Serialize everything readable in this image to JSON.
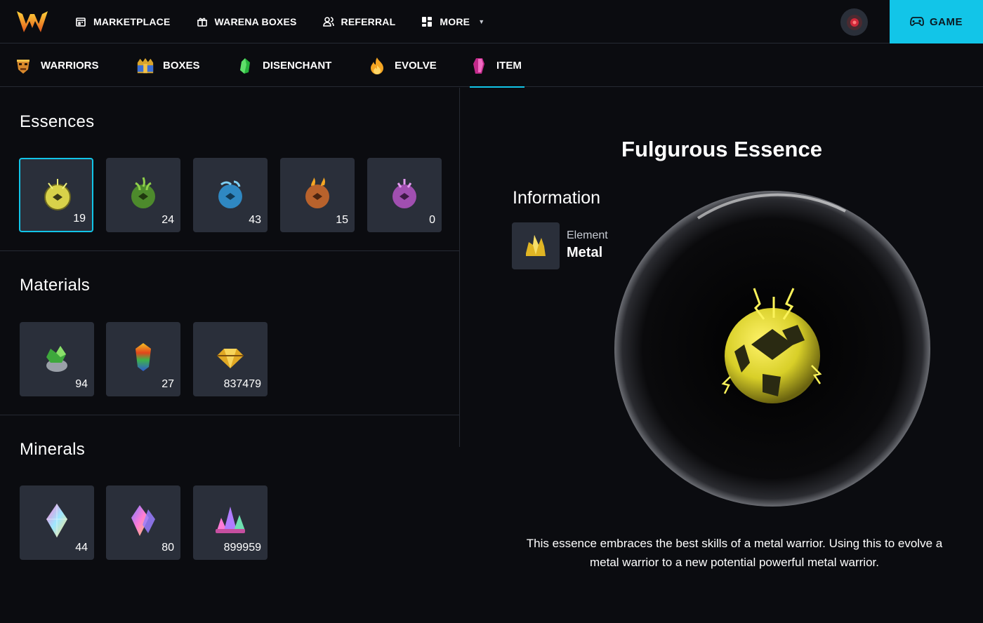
{
  "header": {
    "nav": [
      {
        "label": "MARKETPLACE",
        "icon": "shop-icon"
      },
      {
        "label": "WARENA BOXES",
        "icon": "gift-icon"
      },
      {
        "label": "REFERRAL",
        "icon": "users-icon"
      },
      {
        "label": "MORE",
        "icon": "grid-icon"
      }
    ],
    "game_button": "GAME"
  },
  "tabs": [
    {
      "label": "WARRIORS",
      "icon": "warrior-mask-icon"
    },
    {
      "label": "BOXES",
      "icon": "box-icon"
    },
    {
      "label": "DISENCHANT",
      "icon": "green-gem-icon"
    },
    {
      "label": "EVOLVE",
      "icon": "flame-icon"
    },
    {
      "label": "ITEM",
      "icon": "pink-crystal-icon",
      "active": true
    }
  ],
  "sections": {
    "essences": {
      "title": "Essences",
      "items": [
        {
          "icon": "metal-essence-icon",
          "count": "19",
          "color": "#d8d24a",
          "selected": true
        },
        {
          "icon": "wood-essence-icon",
          "count": "24",
          "color": "#5fa83a"
        },
        {
          "icon": "water-essence-icon",
          "count": "43",
          "color": "#3a9ad1"
        },
        {
          "icon": "fire-essence-icon",
          "count": "15",
          "color": "#c8753a"
        },
        {
          "icon": "earth-essence-icon",
          "count": "0",
          "color": "#b25ac2"
        }
      ]
    },
    "materials": {
      "title": "Materials",
      "items": [
        {
          "icon": "green-ore-icon",
          "count": "94"
        },
        {
          "icon": "rainbow-ore-icon",
          "count": "27"
        },
        {
          "icon": "gold-ore-icon",
          "count": "837479"
        }
      ]
    },
    "minerals": {
      "title": "Minerals",
      "items": [
        {
          "icon": "crystal-icon",
          "count": "44"
        },
        {
          "icon": "double-crystal-icon",
          "count": "80"
        },
        {
          "icon": "crystal-cluster-icon",
          "count": "899959"
        }
      ]
    }
  },
  "detail": {
    "title": "Fulgurous Essence",
    "info_title": "Information",
    "element_label": "Element",
    "element_value": "Metal",
    "element_icon": "metal-element-icon",
    "description": "This essence embraces the best skills of a metal warrior. Using this to evolve a metal warrior to a new potential powerful metal warrior."
  },
  "colors": {
    "accent": "#12c5e8",
    "background": "#0b0c10",
    "slot": "#2a2f3a"
  }
}
